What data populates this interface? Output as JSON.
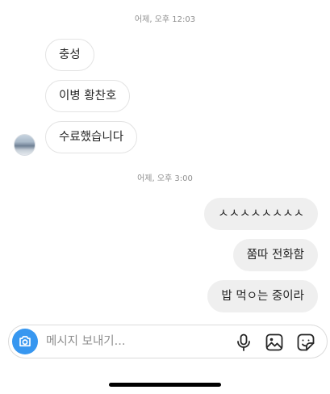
{
  "timestamps": [
    "어제, 오후 12:03",
    "어제, 오후 3:00"
  ],
  "received_messages": [
    "충성",
    "이병 황찬호",
    "수료했습니다"
  ],
  "sent_messages": [
    "ㅅㅅㅅㅅㅅㅅㅅㅅ",
    "쭘따 전화함",
    "밥 먹ㅇ는 중이라"
  ],
  "composer": {
    "placeholder": "메시지 보내기...",
    "icons": [
      "camera-icon",
      "microphone-icon",
      "gallery-icon",
      "sticker-icon"
    ]
  },
  "colors": {
    "accent": "#3797f0",
    "sent_bubble": "#efefef",
    "received_border": "#e3e3e3"
  }
}
